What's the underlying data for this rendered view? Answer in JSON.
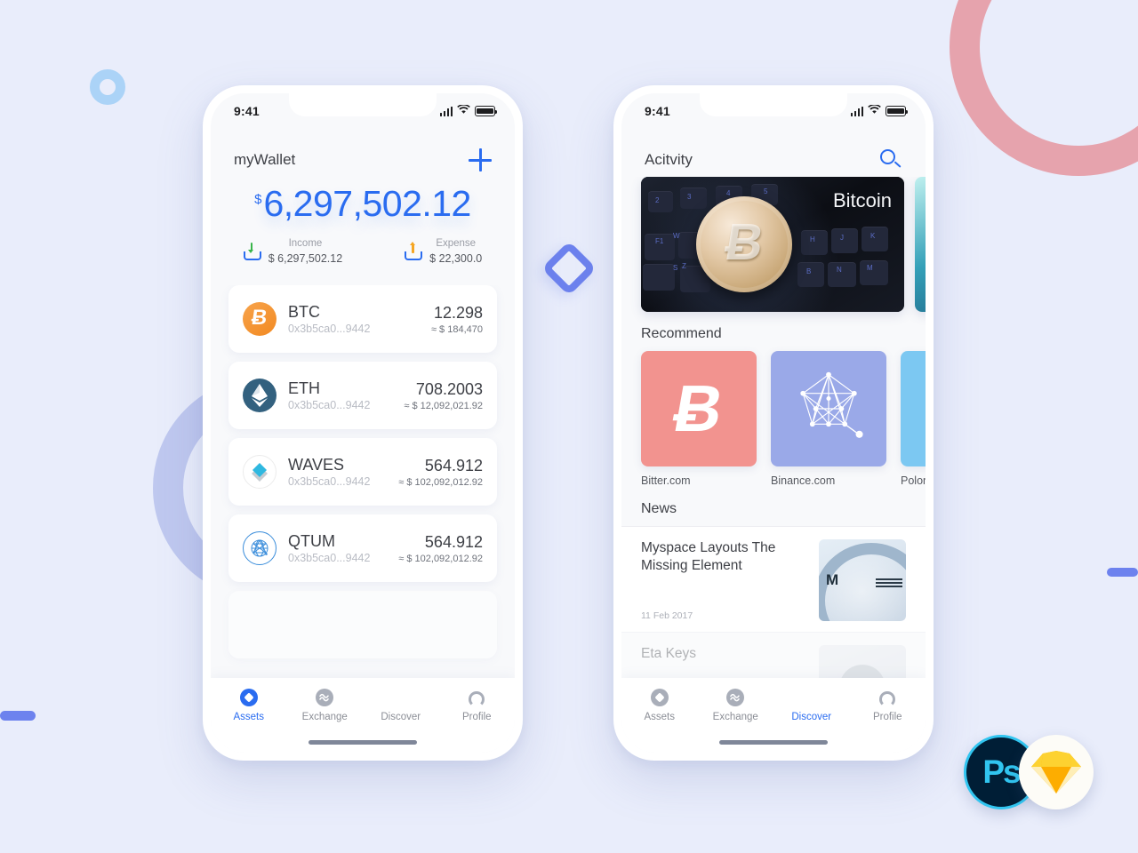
{
  "background": {
    "color": "#e9edfb",
    "decorations": [
      {
        "name": "pink-ring",
        "color": "#e6a3ad"
      },
      {
        "name": "small-blue-ring",
        "color": "#abd3f7"
      },
      {
        "name": "periwinkle-ring",
        "color": "#bfc8ef"
      },
      {
        "name": "diamond-outline",
        "color": "#6d82ee"
      },
      {
        "name": "left-bar",
        "color": "#6d82ee"
      },
      {
        "name": "right-bar",
        "color": "#6d82ee"
      }
    ]
  },
  "accent": {
    "blue": "#2a6cf0",
    "grey_text": "#8b8e96"
  },
  "wallet_screen": {
    "status_bar": {
      "time": "9:41",
      "signal": "signal-icon",
      "wifi": "wifi-icon",
      "battery": "battery-icon"
    },
    "header": {
      "title": "myWallet",
      "add_icon": "plus-icon"
    },
    "balance": {
      "currency": "$",
      "amount": "6,297,502.12"
    },
    "summary": [
      {
        "icon": "income-icon",
        "label": "Income",
        "amount": "$ 6,297,502.12"
      },
      {
        "icon": "expense-icon",
        "label": "Expense",
        "amount": "$ 22,300.0"
      }
    ],
    "assets": [
      {
        "icon": "btc-icon",
        "symbol": "BTC",
        "address": "0x3b5ca0...9442",
        "amount": "12.298",
        "usd": "≈ $ 184,470"
      },
      {
        "icon": "eth-icon",
        "symbol": "ETH",
        "address": "0x3b5ca0...9442",
        "amount": "708.2003",
        "usd": "≈ $ 12,092,021.92"
      },
      {
        "icon": "waves-icon",
        "symbol": "WAVES",
        "address": "0x3b5ca0...9442",
        "amount": "564.912",
        "usd": "≈ $ 102,092,012.92"
      },
      {
        "icon": "qtum-icon",
        "symbol": "QTUM",
        "address": "0x3b5ca0...9442",
        "amount": "564.912",
        "usd": "≈ $ 102,092,012.92"
      }
    ],
    "tabs": [
      {
        "icon": "assets-icon",
        "label": "Assets",
        "active": true
      },
      {
        "icon": "exchange-icon",
        "label": "Exchange",
        "active": false
      },
      {
        "icon": "discover-icon",
        "label": "Discover",
        "active": false
      },
      {
        "icon": "profile-icon",
        "label": "Profile",
        "active": false
      }
    ]
  },
  "discover_screen": {
    "status_bar": {
      "time": "9:41",
      "signal": "signal-icon",
      "wifi": "wifi-icon",
      "battery": "battery-icon"
    },
    "header": {
      "title": "Acitvity",
      "search_icon": "search-icon"
    },
    "banner": {
      "caption": "Bitcoin",
      "symbol": "Ƀ"
    },
    "sections": {
      "recommend": "Recommend",
      "news": "News"
    },
    "recommend": [
      {
        "name": "Bitter.com",
        "color": "#f2938f",
        "logo": "bitcoin-logo"
      },
      {
        "name": "Binance.com",
        "color": "#9aa9e8",
        "logo": "binance-network-logo"
      },
      {
        "name": "Polonie",
        "color": "#7cc8f2",
        "logo": "poloniex-logo"
      }
    ],
    "news": [
      {
        "title": "Myspace Layouts The Missing Element",
        "date": "11 Feb 2017",
        "thumb": "ibm-thumbnail"
      },
      {
        "title": "Eta Keys",
        "date": "",
        "thumb": "person-thumbnail"
      }
    ],
    "tabs": [
      {
        "icon": "assets-icon",
        "label": "Assets",
        "active": false
      },
      {
        "icon": "exchange-icon",
        "label": "Exchange",
        "active": false
      },
      {
        "icon": "discover-icon",
        "label": "Discover",
        "active": true
      },
      {
        "icon": "profile-icon",
        "label": "Profile",
        "active": false
      }
    ]
  },
  "tool_badges": [
    {
      "name": "photoshop-badge",
      "label": "Ps"
    },
    {
      "name": "sketch-badge",
      "label": "sketch-diamond"
    }
  ]
}
